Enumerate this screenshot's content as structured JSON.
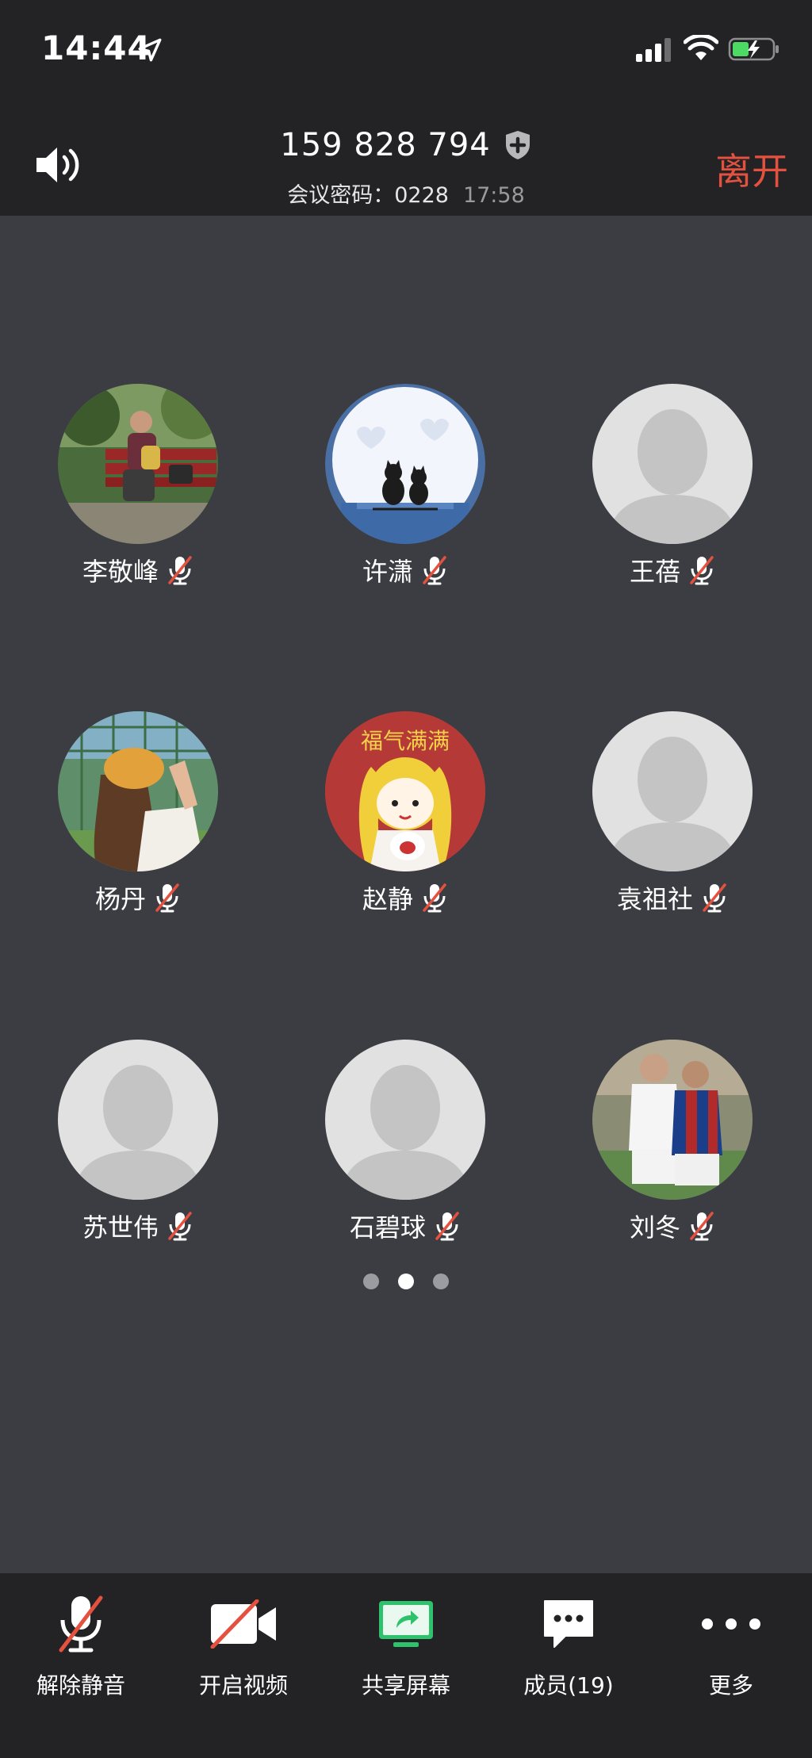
{
  "status_bar": {
    "time": "14:44"
  },
  "header": {
    "meeting_id": "159 828 794",
    "password_label": "会议密码：0228",
    "duration": "17:58",
    "leave_label": "离开"
  },
  "participants": [
    {
      "name": "李敬峰",
      "avatar": "photo-park"
    },
    {
      "name": "许潇",
      "avatar": "photo-cats"
    },
    {
      "name": "王蓓",
      "avatar": "default"
    },
    {
      "name": "杨丹",
      "avatar": "photo-girl"
    },
    {
      "name": "赵静",
      "avatar": "photo-cartoon",
      "avatar_text": "福气满满"
    },
    {
      "name": "袁祖社",
      "avatar": "default"
    },
    {
      "name": "苏世伟",
      "avatar": "default"
    },
    {
      "name": "石碧球",
      "avatar": "default"
    },
    {
      "name": "刘冬",
      "avatar": "photo-football"
    }
  ],
  "pager": {
    "pages": 3,
    "current": 2
  },
  "toolbar": {
    "unmute_label": "解除静音",
    "video_label": "开启视频",
    "share_label": "共享屏幕",
    "members_label": "成员(19)",
    "more_label": "更多"
  },
  "colors": {
    "accent_leave": "#e4513f",
    "share_green": "#2dc26b",
    "mute_red": "#e4513f"
  }
}
